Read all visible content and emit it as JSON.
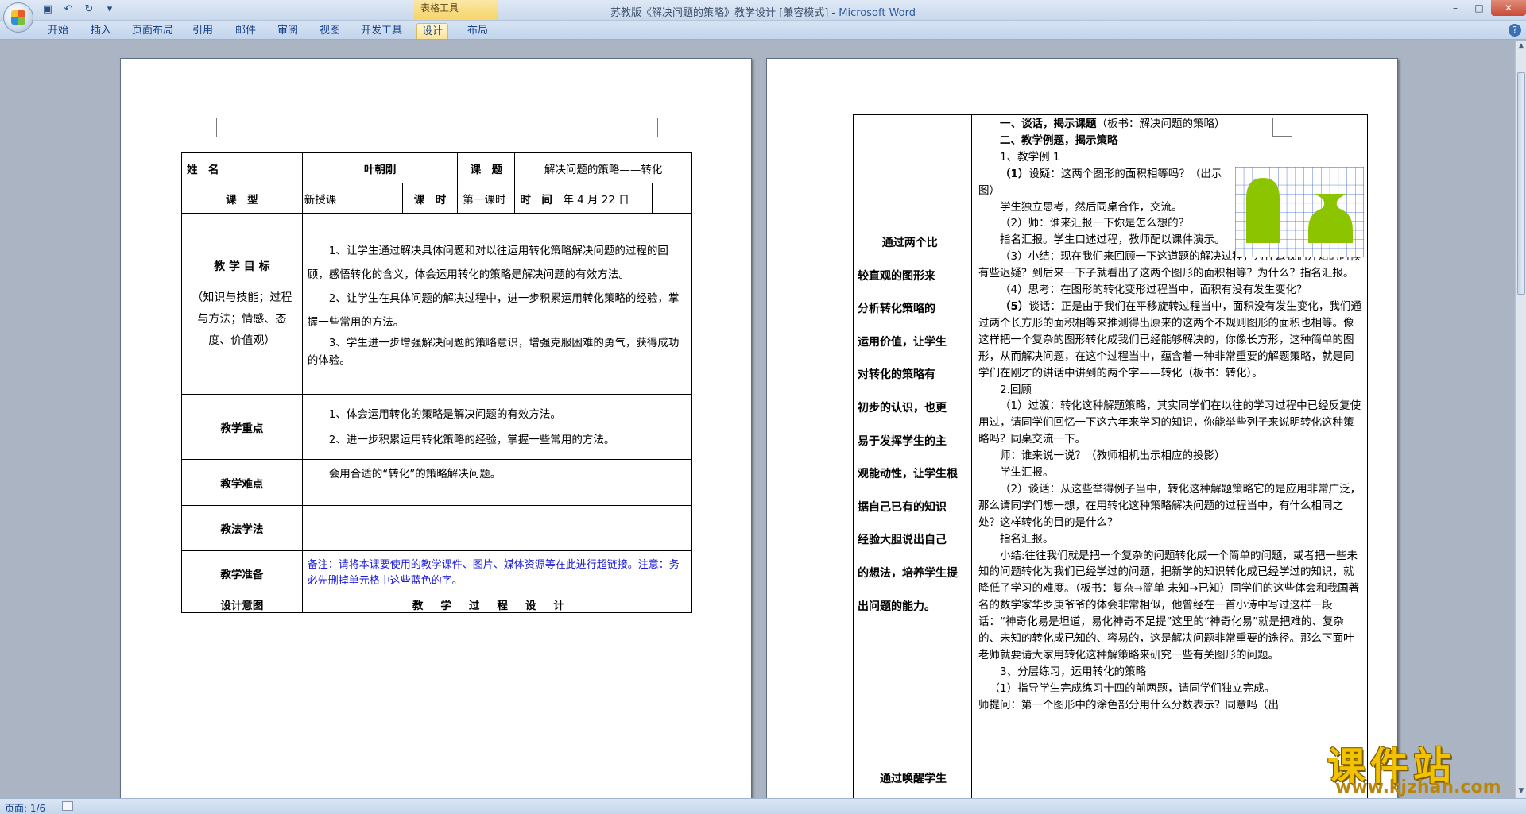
{
  "window": {
    "title": "苏教版《解决问题的策略》教学设计 [兼容模式] - ",
    "app_name": "Microsoft Word",
    "context_tab_group": "表格工具",
    "controls": [
      "–",
      "□",
      "✕"
    ]
  },
  "ribbon": {
    "tabs": [
      "开始",
      "插入",
      "页面布局",
      "引用",
      "邮件",
      "审阅",
      "视图",
      "开发工具",
      "设计",
      "布局"
    ],
    "active_tab": "设计"
  },
  "page1": {
    "row1": {
      "name_label": "姓　名",
      "name_value": "叶朝刚",
      "topic_label": "课　题",
      "topic_value": "解决问题的策略——转化"
    },
    "row2": {
      "type_label": "课　型",
      "type_value": "新授课",
      "hours_label": "课　时",
      "hours_value": "第一课时",
      "time_label": "时　间",
      "time_value": "年 4 月 22 日"
    },
    "goals": {
      "label": "教 学 目 标",
      "sub_label": "（知识与技能；过程与方法；情感、态度、价值观）",
      "items": [
        "1、让学生通过解决具体问题和对以往运用转化策略解决问题的过程的回顾，感悟转化的含义，体会运用转化的策略是解决问题的有效方法。",
        "2、让学生在具体问题的解决过程中，进一步积累运用转化策略的经验，掌握一些常用的方法。",
        "3、学生进一步增强解决问题的策略意识，增强克服困难的勇气，获得成功的体验。"
      ]
    },
    "key_points": {
      "label": "教学重点",
      "items": [
        "1、体会运用转化的策略是解决问题的有效方法。",
        "2、进一步积累运用转化策略的经验，掌握一些常用的方法。"
      ]
    },
    "difficulty": {
      "label": "教学难点",
      "text": "会用合适的“转化”的策略解决问题。"
    },
    "methods": {
      "label": "教法学法",
      "text": ""
    },
    "preparation": {
      "label": "教学准备",
      "text": "备注：请将本课要使用的教学课件、图片、媒体资源等在此进行超链接。注意：务必先删掉单元格中这些蓝色的字。"
    },
    "footer_row": {
      "left": "设计意图",
      "right": "教学过程设计"
    }
  },
  "page2": {
    "left_lines": [
      "通过两个比",
      "较直观的图形来",
      "分析转化策略的",
      "运用价值，让学生",
      "对转化的策略有",
      "初步的认识，也更",
      "易于发挥学生的主",
      "观能动性，让学生根",
      "据自己已有的知识",
      "经验大胆说出自己",
      "的想法，培养学生提",
      "出问题的能力。"
    ],
    "left_bottom": "通过唤醒学生",
    "right": {
      "h1_bold": "一、谈话，揭示课题",
      "h1_rest": "（板书：解决问题的策略）",
      "h2": "二、教学例题，揭示策略",
      "p1": "1、教学例 1",
      "p2_bold": "（1）",
      "p2": "设疑：这两个图形的面积相等吗？（出示图）",
      "p3": "学生独立思考，然后同桌合作，交流。",
      "p4": "（2）师：谁来汇报一下你是怎么想的？",
      "p5": "指名汇报。学生口述过程，教师配以课件演示。",
      "p6": "（3）小结：现在我们来回顾一下这道题的解决过程，为什么我们开始的时候有些迟疑？到后来一下子就看出了这两个图形的面积相等？为什么？指名汇报。",
      "p7": "（4）思考：在图形的转化变形过程当中，面积有没有发生变化？",
      "p8_bold": "（5）",
      "p8": "谈话：正是由于我们在平移旋转过程当中，面积没有发生变化，我们通过两个长方形的面积相等来推测得出原来的这两个不规则图形的面积也相等。像这样把一个复杂的图形转化成我们已经能够解决的，你像长方形，这种简单的图形，从而解决问题，在这个过程当中，蕴含着一种非常重要的解题策略，就是同学们在刚才的讲话中讲到的两个字——转化（板书：转化）。",
      "p9": "2.回顾",
      "p10": "（1）过渡：转化这种解题策略，其实同学们在以往的学习过程中已经反复使用过，请同学们回忆一下这六年来学习的知识，你能举些列子来说明转化这种策略吗？同桌交流一下。",
      "p11": "师：谁来说一说？（教师相机出示相应的投影）",
      "p12": "学生汇报。",
      "p13": "（2）谈话：从这些举得例子当中，转化这种解题策略它的是应用非常广泛，那么请同学们想一想，在用转化这种策略解决问题的过程当中，有什么相同之处？这样转化的目的是什么？",
      "p14": "指名汇报。",
      "p15": "小结:往往我们就是把一个复杂的问题转化成一个简单的问题，或者把一些未知的问题转化为我们已经学过的问题，把新学的知识转化成已经学过的知识，就降低了学习的难度。（板书：复杂→简单 未知→已知）同学们的这些体会和我国著名的数学家华罗庚爷爷的体会非常相似，他曾经在一首小诗中写过这样一段话：“神奇化易是坦道，易化神奇不足提”这里的“神奇化易”就是把难的、复杂的、未知的转化成已知的、容易的，这是解决问题非常重要的途径。那么下面叶老师就要请大家用转化这种解策略来研究一些有关图形的问题。",
      "p16": "3、分层练习，运用转化的策略",
      "p17": "（1）指导学生完成练习十四的前两题，请同学们独立完成。",
      "p18": "师提问：第一个图形中的涂色部分用什么分数表示？同意吗（出"
    }
  },
  "status": {
    "page": "页面: 1/6"
  },
  "watermark": {
    "brand": "课件站",
    "url": "www.kjzhan.com"
  },
  "colors": {
    "figure_fill": "#8dc400",
    "grid_line": "#2f55d6",
    "hint_blue": "#1a1ad8",
    "watermark_gold": "#f2c200"
  }
}
